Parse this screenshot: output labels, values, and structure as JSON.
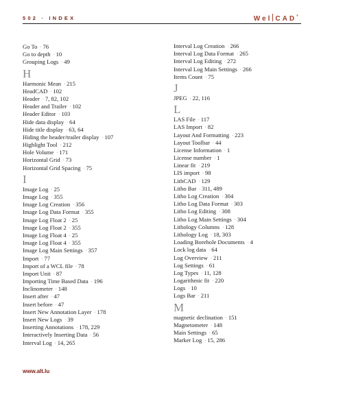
{
  "header": {
    "page_label": "502 · INDEX",
    "logo": {
      "left": "Wel",
      "right": "CAD",
      "mark": "®"
    }
  },
  "colors": {
    "accent": "#7a2a1c",
    "logo": "#a2402c",
    "section_letter": "#888888"
  },
  "columns": [
    {
      "items": [
        {
          "type": "entry",
          "term": "Go To",
          "pages": "76"
        },
        {
          "type": "entry",
          "term": "Go to depth",
          "pages": "10"
        },
        {
          "type": "entry",
          "term": "Grouping Logs",
          "pages": "49"
        },
        {
          "type": "letter",
          "letter": "H"
        },
        {
          "type": "entry",
          "term": "Harmonic Mean",
          "pages": "215"
        },
        {
          "type": "entry",
          "term": "HeadCAD",
          "pages": "102"
        },
        {
          "type": "entry",
          "term": "Header",
          "pages": "7, 82, 102"
        },
        {
          "type": "entry",
          "term": "Header and Trailer",
          "pages": "102"
        },
        {
          "type": "entry",
          "term": "Header Editor",
          "pages": "103"
        },
        {
          "type": "entry",
          "term": "Hide data display",
          "pages": "64"
        },
        {
          "type": "entry",
          "term": "Hide title display",
          "pages": "63, 64"
        },
        {
          "type": "entry",
          "term": "Hiding the header/trailer display",
          "pages": "107"
        },
        {
          "type": "entry",
          "term": "Highlight Tool",
          "pages": "212"
        },
        {
          "type": "entry",
          "term": "Hole Volume",
          "pages": "171"
        },
        {
          "type": "entry",
          "term": "Horizontal Grid",
          "pages": "73"
        },
        {
          "type": "entry",
          "term": "Horizontal Grid Spacing",
          "pages": "75"
        },
        {
          "type": "letter",
          "letter": "I"
        },
        {
          "type": "entry",
          "term": "Image Log",
          "pages": "25"
        },
        {
          "type": "entry",
          "term": "Image Log",
          "pages": "355"
        },
        {
          "type": "entry",
          "term": "Image Log Creation",
          "pages": "356"
        },
        {
          "type": "entry",
          "term": "Image Log Data Format",
          "pages": "355"
        },
        {
          "type": "entry",
          "term": "Image Log Float 2",
          "pages": "25"
        },
        {
          "type": "entry",
          "term": "Image Log Float 2",
          "pages": "355"
        },
        {
          "type": "entry",
          "term": "Image Log Float 4",
          "pages": "25"
        },
        {
          "type": "entry",
          "term": "Image Log Float 4",
          "pages": "355"
        },
        {
          "type": "entry",
          "term": "Image Log Main Settings",
          "pages": "357"
        },
        {
          "type": "entry",
          "term": "Import",
          "pages": "77"
        },
        {
          "type": "entry",
          "term": "Import of a WCL file",
          "pages": "78"
        },
        {
          "type": "entry",
          "term": "Import Unit",
          "pages": "87"
        },
        {
          "type": "entry",
          "term": "Importing Time Based Data",
          "pages": "196"
        },
        {
          "type": "entry",
          "term": "Inclinometer",
          "pages": "148"
        },
        {
          "type": "entry",
          "term": "Insert after",
          "pages": "47"
        },
        {
          "type": "entry",
          "term": "Insert before",
          "pages": "47"
        },
        {
          "type": "entry",
          "term": "Insert New Annotation Layer",
          "pages": "178"
        },
        {
          "type": "entry",
          "term": "Insert New Logs",
          "pages": "39"
        },
        {
          "type": "entry",
          "term": "Inserting Annotations",
          "pages": "178, 229"
        },
        {
          "type": "entry",
          "term": "Interactively Inserting Data",
          "pages": "56"
        },
        {
          "type": "entry",
          "term": "Interval Log",
          "pages": "14, 265"
        }
      ]
    },
    {
      "items": [
        {
          "type": "entry",
          "term": "Interval Log Creation",
          "pages": "266"
        },
        {
          "type": "entry",
          "term": "Interval Log Data Format",
          "pages": "265"
        },
        {
          "type": "entry",
          "term": "Interval Log Editing",
          "pages": "272"
        },
        {
          "type": "entry",
          "term": "Interval Log Main Settings",
          "pages": "266"
        },
        {
          "type": "entry",
          "term": "Items Count",
          "pages": "75"
        },
        {
          "type": "letter",
          "letter": "J"
        },
        {
          "type": "entry",
          "term": "JPEG",
          "pages": "22, 116"
        },
        {
          "type": "letter",
          "letter": "L"
        },
        {
          "type": "entry",
          "term": "LAS File",
          "pages": "117"
        },
        {
          "type": "entry",
          "term": "LAS Import",
          "pages": "82"
        },
        {
          "type": "entry",
          "term": "Layout And Formatting",
          "pages": "223"
        },
        {
          "type": "entry",
          "term": "Layout Toolbar",
          "pages": "44"
        },
        {
          "type": "entry",
          "term": "License Information",
          "pages": "1"
        },
        {
          "type": "entry",
          "term": "License number",
          "pages": "1"
        },
        {
          "type": "entry",
          "term": "Linear fit",
          "pages": "219"
        },
        {
          "type": "entry",
          "term": "LIS import",
          "pages": "98"
        },
        {
          "type": "entry",
          "term": "LithCAD",
          "pages": "129"
        },
        {
          "type": "entry",
          "term": "Litho Bar",
          "pages": "311, 489"
        },
        {
          "type": "entry",
          "term": "Litho Log Creation",
          "pages": "304"
        },
        {
          "type": "entry",
          "term": "Litho Log Data Format",
          "pages": "303"
        },
        {
          "type": "entry",
          "term": "Litho Log Editing",
          "pages": "308"
        },
        {
          "type": "entry",
          "term": "Litho Log Main Settings",
          "pages": "304"
        },
        {
          "type": "entry",
          "term": "Lithology Columns",
          "pages": "128"
        },
        {
          "type": "entry",
          "term": "Lithology Log",
          "pages": "18, 303"
        },
        {
          "type": "entry",
          "term": "Loading Borehole Documents",
          "pages": "4"
        },
        {
          "type": "entry",
          "term": "Lock log data",
          "pages": "64"
        },
        {
          "type": "entry",
          "term": "Log Overview",
          "pages": "211"
        },
        {
          "type": "entry",
          "term": "Log Settings",
          "pages": "61"
        },
        {
          "type": "entry",
          "term": "Log Types",
          "pages": "11, 128"
        },
        {
          "type": "entry",
          "term": "Logarithmic fit",
          "pages": "220"
        },
        {
          "type": "entry",
          "term": "Logs",
          "pages": "10"
        },
        {
          "type": "entry",
          "term": "Logs Bar",
          "pages": "211"
        },
        {
          "type": "letter",
          "letter": "M"
        },
        {
          "type": "entry",
          "term": "magnetic declination",
          "pages": "151"
        },
        {
          "type": "entry",
          "term": "Magnetometer",
          "pages": "148"
        },
        {
          "type": "entry",
          "term": "Main Settings",
          "pages": "65"
        },
        {
          "type": "entry",
          "term": "Marker Log",
          "pages": "15, 286"
        }
      ]
    }
  ],
  "footer": {
    "url_text": "www.alt.lu"
  }
}
